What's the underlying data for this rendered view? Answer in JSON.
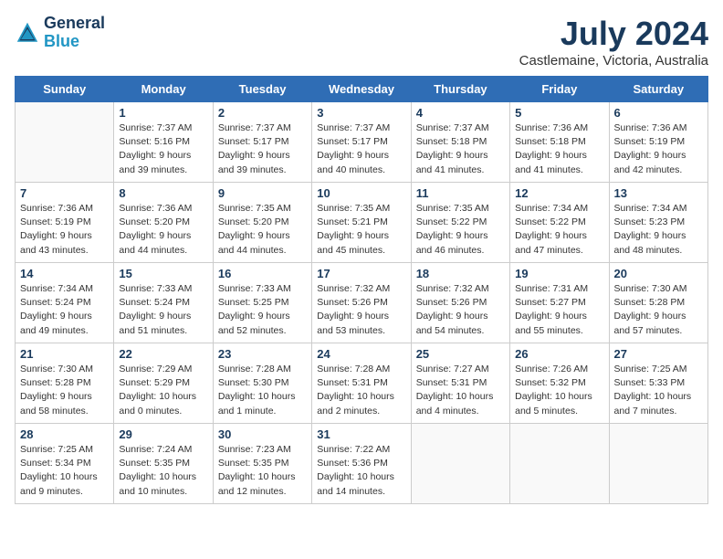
{
  "header": {
    "logo_line1": "General",
    "logo_line2": "Blue",
    "month_year": "July 2024",
    "location": "Castlemaine, Victoria, Australia"
  },
  "weekdays": [
    "Sunday",
    "Monday",
    "Tuesday",
    "Wednesday",
    "Thursday",
    "Friday",
    "Saturday"
  ],
  "weeks": [
    [
      {
        "day": "",
        "detail": ""
      },
      {
        "day": "1",
        "detail": "Sunrise: 7:37 AM\nSunset: 5:16 PM\nDaylight: 9 hours\nand 39 minutes."
      },
      {
        "day": "2",
        "detail": "Sunrise: 7:37 AM\nSunset: 5:17 PM\nDaylight: 9 hours\nand 39 minutes."
      },
      {
        "day": "3",
        "detail": "Sunrise: 7:37 AM\nSunset: 5:17 PM\nDaylight: 9 hours\nand 40 minutes."
      },
      {
        "day": "4",
        "detail": "Sunrise: 7:37 AM\nSunset: 5:18 PM\nDaylight: 9 hours\nand 41 minutes."
      },
      {
        "day": "5",
        "detail": "Sunrise: 7:36 AM\nSunset: 5:18 PM\nDaylight: 9 hours\nand 41 minutes."
      },
      {
        "day": "6",
        "detail": "Sunrise: 7:36 AM\nSunset: 5:19 PM\nDaylight: 9 hours\nand 42 minutes."
      }
    ],
    [
      {
        "day": "7",
        "detail": "Sunrise: 7:36 AM\nSunset: 5:19 PM\nDaylight: 9 hours\nand 43 minutes."
      },
      {
        "day": "8",
        "detail": "Sunrise: 7:36 AM\nSunset: 5:20 PM\nDaylight: 9 hours\nand 44 minutes."
      },
      {
        "day": "9",
        "detail": "Sunrise: 7:35 AM\nSunset: 5:20 PM\nDaylight: 9 hours\nand 44 minutes."
      },
      {
        "day": "10",
        "detail": "Sunrise: 7:35 AM\nSunset: 5:21 PM\nDaylight: 9 hours\nand 45 minutes."
      },
      {
        "day": "11",
        "detail": "Sunrise: 7:35 AM\nSunset: 5:22 PM\nDaylight: 9 hours\nand 46 minutes."
      },
      {
        "day": "12",
        "detail": "Sunrise: 7:34 AM\nSunset: 5:22 PM\nDaylight: 9 hours\nand 47 minutes."
      },
      {
        "day": "13",
        "detail": "Sunrise: 7:34 AM\nSunset: 5:23 PM\nDaylight: 9 hours\nand 48 minutes."
      }
    ],
    [
      {
        "day": "14",
        "detail": "Sunrise: 7:34 AM\nSunset: 5:24 PM\nDaylight: 9 hours\nand 49 minutes."
      },
      {
        "day": "15",
        "detail": "Sunrise: 7:33 AM\nSunset: 5:24 PM\nDaylight: 9 hours\nand 51 minutes."
      },
      {
        "day": "16",
        "detail": "Sunrise: 7:33 AM\nSunset: 5:25 PM\nDaylight: 9 hours\nand 52 minutes."
      },
      {
        "day": "17",
        "detail": "Sunrise: 7:32 AM\nSunset: 5:26 PM\nDaylight: 9 hours\nand 53 minutes."
      },
      {
        "day": "18",
        "detail": "Sunrise: 7:32 AM\nSunset: 5:26 PM\nDaylight: 9 hours\nand 54 minutes."
      },
      {
        "day": "19",
        "detail": "Sunrise: 7:31 AM\nSunset: 5:27 PM\nDaylight: 9 hours\nand 55 minutes."
      },
      {
        "day": "20",
        "detail": "Sunrise: 7:30 AM\nSunset: 5:28 PM\nDaylight: 9 hours\nand 57 minutes."
      }
    ],
    [
      {
        "day": "21",
        "detail": "Sunrise: 7:30 AM\nSunset: 5:28 PM\nDaylight: 9 hours\nand 58 minutes."
      },
      {
        "day": "22",
        "detail": "Sunrise: 7:29 AM\nSunset: 5:29 PM\nDaylight: 10 hours\nand 0 minutes."
      },
      {
        "day": "23",
        "detail": "Sunrise: 7:28 AM\nSunset: 5:30 PM\nDaylight: 10 hours\nand 1 minute."
      },
      {
        "day": "24",
        "detail": "Sunrise: 7:28 AM\nSunset: 5:31 PM\nDaylight: 10 hours\nand 2 minutes."
      },
      {
        "day": "25",
        "detail": "Sunrise: 7:27 AM\nSunset: 5:31 PM\nDaylight: 10 hours\nand 4 minutes."
      },
      {
        "day": "26",
        "detail": "Sunrise: 7:26 AM\nSunset: 5:32 PM\nDaylight: 10 hours\nand 5 minutes."
      },
      {
        "day": "27",
        "detail": "Sunrise: 7:25 AM\nSunset: 5:33 PM\nDaylight: 10 hours\nand 7 minutes."
      }
    ],
    [
      {
        "day": "28",
        "detail": "Sunrise: 7:25 AM\nSunset: 5:34 PM\nDaylight: 10 hours\nand 9 minutes."
      },
      {
        "day": "29",
        "detail": "Sunrise: 7:24 AM\nSunset: 5:35 PM\nDaylight: 10 hours\nand 10 minutes."
      },
      {
        "day": "30",
        "detail": "Sunrise: 7:23 AM\nSunset: 5:35 PM\nDaylight: 10 hours\nand 12 minutes."
      },
      {
        "day": "31",
        "detail": "Sunrise: 7:22 AM\nSunset: 5:36 PM\nDaylight: 10 hours\nand 14 minutes."
      },
      {
        "day": "",
        "detail": ""
      },
      {
        "day": "",
        "detail": ""
      },
      {
        "day": "",
        "detail": ""
      }
    ]
  ]
}
